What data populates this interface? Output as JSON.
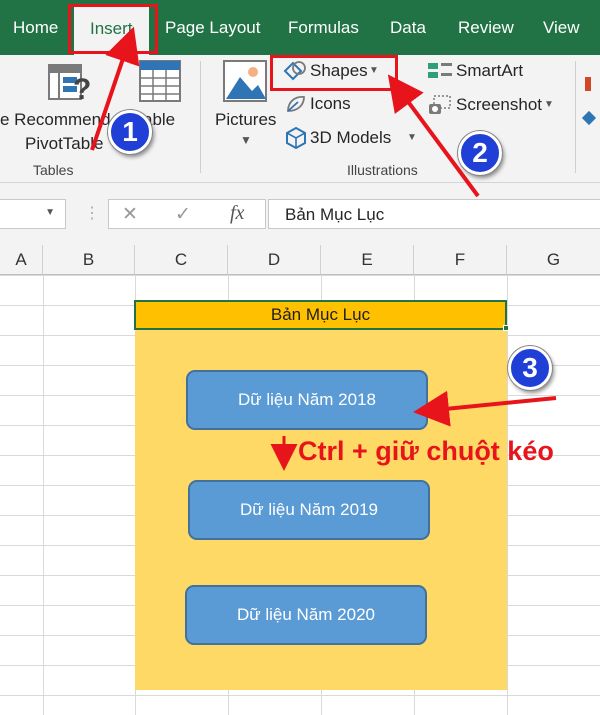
{
  "ribbon_tabs": [
    {
      "label": "Home"
    },
    {
      "label": "Insert",
      "active": true
    },
    {
      "label": "Page Layout"
    },
    {
      "label": "Formulas"
    },
    {
      "label": "Data"
    },
    {
      "label": "Review"
    },
    {
      "label": "View"
    }
  ],
  "tables_group": {
    "recommended_pivot_line1": "e Recommend",
    "recommended_pivot_line2": "PivotTable",
    "table_label": "able",
    "group_label": "Tables"
  },
  "illustrations_group": {
    "pictures_label": "Pictures",
    "shapes_label": "Shapes",
    "icons_label": "Icons",
    "models_label": "3D Models",
    "smartart_label": "SmartArt",
    "screenshot_label": "Screenshot",
    "group_label": "Illustrations"
  },
  "formula_bar": {
    "cancel_glyph": "✕",
    "enter_glyph": "✓",
    "fx_label": "fx",
    "content": "Bản Mục Lục"
  },
  "columns": [
    "A",
    "B",
    "C",
    "D",
    "E",
    "F",
    "G"
  ],
  "sheet": {
    "title_cell": "Bản Mục Lục",
    "shapes": [
      {
        "label": "Dữ liệu Năm 2018"
      },
      {
        "label": "Dữ liệu Năm 2019"
      },
      {
        "label": "Dữ liệu Năm 2020"
      }
    ]
  },
  "annotations": {
    "step1": "1",
    "step2": "2",
    "step3": "3",
    "instruction": "Ctrl + giữ chuột kéo"
  },
  "colors": {
    "excel_green": "#217346",
    "highlight_red": "#e8141c",
    "badge_blue": "#1f3fd6",
    "shape_blue": "#5b9bd5",
    "title_fill": "#ffc000",
    "area_fill": "#ffd966"
  }
}
